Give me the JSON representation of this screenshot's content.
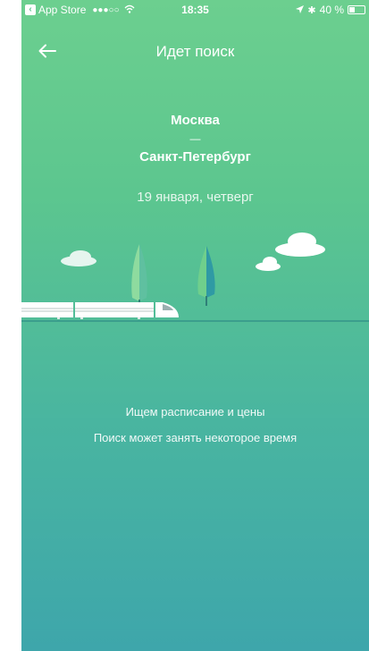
{
  "status_bar": {
    "back_app": "App Store",
    "signal": "●●●○○",
    "time": "18:35",
    "battery": "40 %",
    "battery_level": 0.4
  },
  "nav": {
    "title": "Идет поиск"
  },
  "route": {
    "from": "Москва",
    "separator": "—",
    "to": "Санкт-Петербург",
    "date": "19 января, четверг"
  },
  "messages": {
    "line1": "Ищем расписание и цены",
    "line2": "Поиск может занять некоторое время"
  },
  "colors": {
    "gradient_top": "#6ccf8f",
    "gradient_bottom": "#3ea6ab",
    "tree_green": "#72c98c",
    "tree_teal": "#2f9aa4"
  }
}
